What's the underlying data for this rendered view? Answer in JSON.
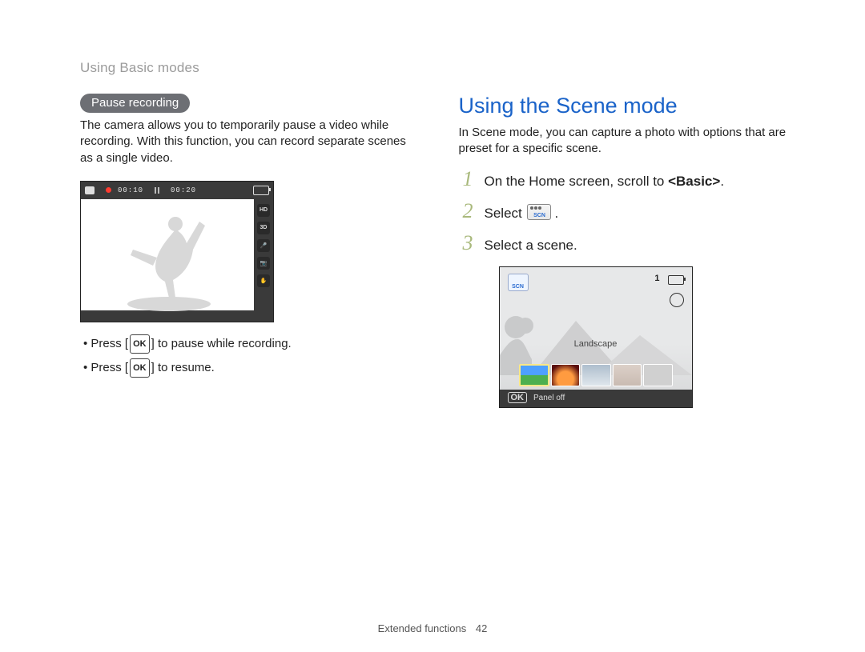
{
  "header": {
    "running_title": "Using Basic modes"
  },
  "left": {
    "pill": "Pause recording",
    "intro": "The camera allows you to temporarily pause a video while recording. With this function, you can record separate scenes as a single video.",
    "screen": {
      "time_elapsed": "00:10",
      "time_total": "00:20",
      "side_icons": {
        "hd": "HD",
        "threed": "3D",
        "mic": "mic",
        "camera": "camera",
        "stabilize": "DIS"
      }
    },
    "bullets": {
      "b1_pre": "Press [",
      "b1_key": "OK",
      "b1_post": "] to pause while recording.",
      "b2_pre": "Press [",
      "b2_key": "OK",
      "b2_post": "] to resume."
    }
  },
  "right": {
    "heading": "Using the Scene mode",
    "intro": "In Scene mode, you can capture a photo with options that are preset for a specific scene.",
    "steps": {
      "s1_pre": "On the Home screen, scroll to ",
      "s1_bold": "<Basic>",
      "s1_post": ".",
      "s2_pre": "Select ",
      "s2_post": ".",
      "s3": "Select a scene."
    },
    "screen": {
      "count": "1",
      "scene_label": "Landscape",
      "footer_key": "OK",
      "footer_text": "Panel off"
    }
  },
  "footer": {
    "section": "Extended functions",
    "page": "42"
  }
}
